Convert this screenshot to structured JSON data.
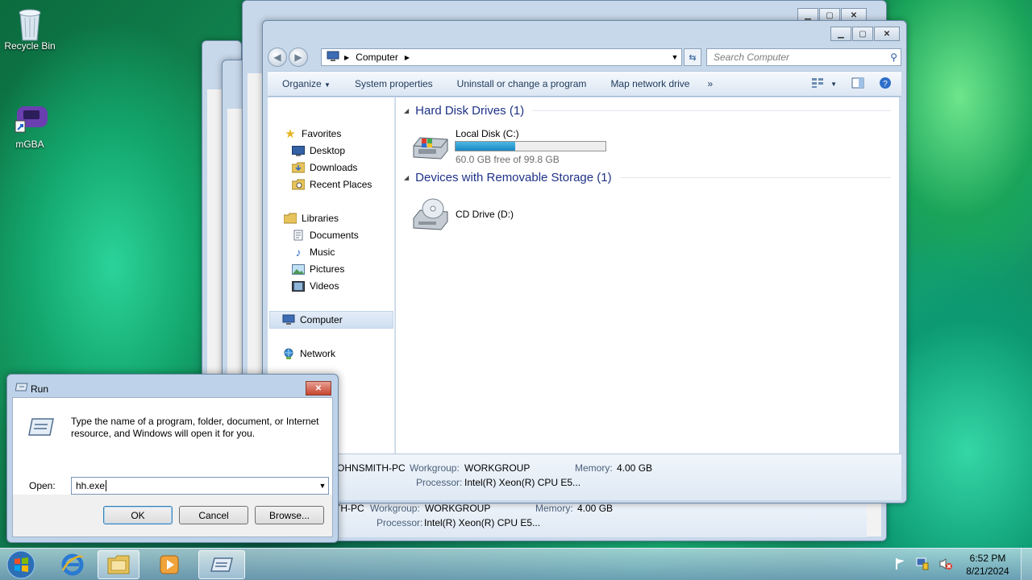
{
  "desktop": {
    "icons": [
      {
        "label": "Recycle Bin",
        "icon": "recycle-bin-icon"
      },
      {
        "label": "mGBA",
        "icon": "mgba-icon"
      }
    ]
  },
  "explorer": {
    "breadcrumb": "Computer",
    "search_placeholder": "Search Computer",
    "toolbar": {
      "organize": "Organize",
      "system_properties": "System properties",
      "uninstall": "Uninstall or change a program",
      "map_drive": "Map network drive",
      "more": "»"
    },
    "nav": {
      "favorites": "Favorites",
      "desktop": "Desktop",
      "downloads": "Downloads",
      "recent": "Recent Places",
      "libraries": "Libraries",
      "documents": "Documents",
      "music": "Music",
      "pictures": "Pictures",
      "videos": "Videos",
      "computer": "Computer",
      "network": "Network"
    },
    "groups": {
      "hdd": "Hard Disk Drives (1)",
      "removable": "Devices with Removable Storage (1)"
    },
    "drives": {
      "c_name": "Local Disk (C:)",
      "c_free": "60.0 GB free of 99.8 GB",
      "c_used_fraction": 0.4,
      "d_name": "CD Drive (D:)"
    },
    "details": {
      "pc_name": "JOHNSMITH-PC",
      "workgroup_label": "Workgroup:",
      "workgroup": "WORKGROUP",
      "memory_label": "Memory:",
      "memory": "4.00 GB",
      "processor_label": "Processor:",
      "processor": "Intel(R) Xeon(R) CPU E5..."
    }
  },
  "back_window_details": {
    "pc_name": "TH-PC",
    "workgroup_label": "Workgroup:",
    "workgroup": "WORKGROUP",
    "memory_label": "Memory:",
    "memory": "4.00 GB",
    "processor_label": "Processor:",
    "processor": "Intel(R) Xeon(R) CPU E5..."
  },
  "run": {
    "title": "Run",
    "description": "Type the name of a program, folder, document, or Internet resource, and Windows will open it for you.",
    "open_label": "Open:",
    "input_value": "hh.exe",
    "ok": "OK",
    "cancel": "Cancel",
    "browse": "Browse..."
  },
  "taskbar": {
    "time": "6:52 PM",
    "date": "8/21/2024"
  }
}
